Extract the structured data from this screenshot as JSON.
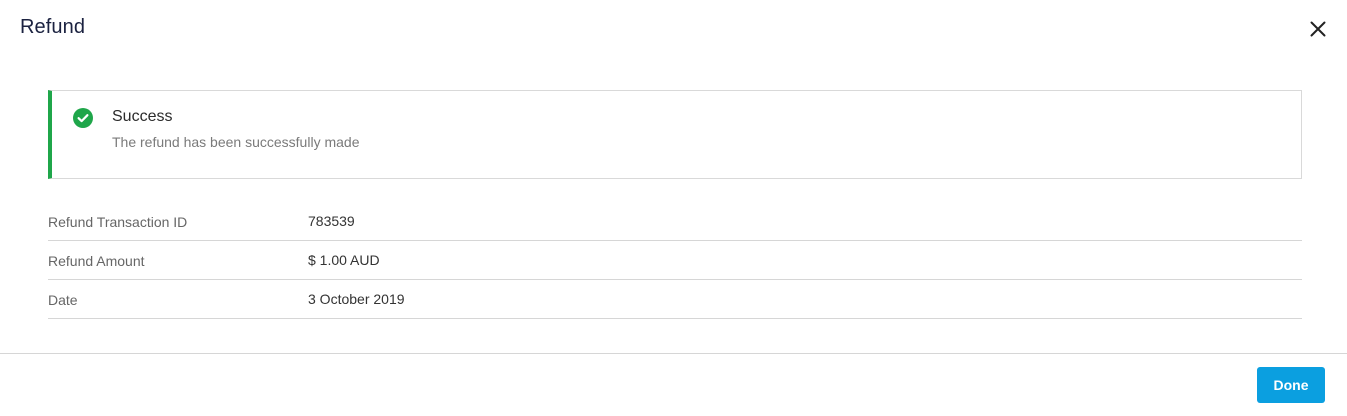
{
  "dialog": {
    "title": "Refund",
    "close_icon": "close-icon"
  },
  "alert": {
    "icon": "check-circle-icon",
    "status_color": "#1fa64a",
    "title": "Success",
    "message": "The refund has been successfully made"
  },
  "details": [
    {
      "label": "Refund Transaction ID",
      "value": "783539"
    },
    {
      "label": "Refund Amount",
      "value": "$ 1.00 AUD"
    },
    {
      "label": "Date",
      "value": "3 October 2019"
    }
  ],
  "footer": {
    "done_label": "Done",
    "accent": "#0b9fe0"
  }
}
